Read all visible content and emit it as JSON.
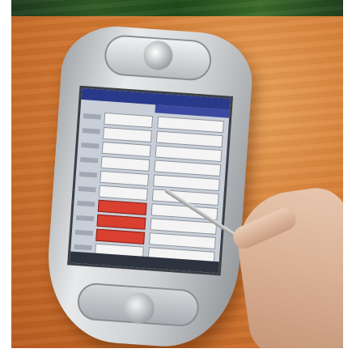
{
  "image": {
    "subject": "pda-device-with-stylus",
    "colors": {
      "table_surface": "#d47a33",
      "device_body": "#cfd2d4",
      "screen_background": "#c8cfd8",
      "screen_titlebar": "#2a3a8a",
      "form_fields_highlight": "#d94030",
      "hand_skin": "#d9b094"
    }
  }
}
